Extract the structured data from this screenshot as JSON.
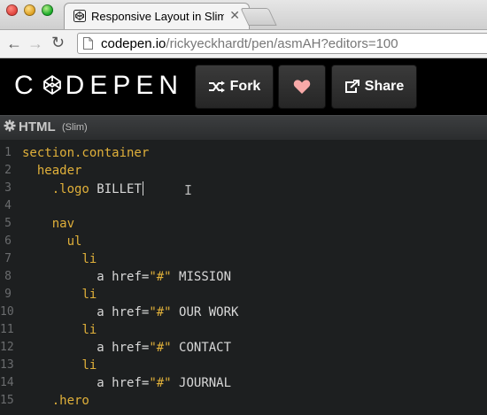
{
  "browser": {
    "tab_title": "Responsive Layout in Slim",
    "tab_close": "✕",
    "url_domain": "codepen.io",
    "url_path": "/rickyeckhardt/pen/asmAH?editors=100"
  },
  "header": {
    "logo_left": "C",
    "logo_right": "DEPEN",
    "fork_label": "Fork",
    "share_label": "Share"
  },
  "pane": {
    "title": "HTML",
    "subtitle": "(Slim)"
  },
  "editor": {
    "lines": [
      {
        "n": "1",
        "indent": "",
        "kw": "section.container",
        "rest": ""
      },
      {
        "n": "2",
        "indent": "  ",
        "kw": "header",
        "rest": ""
      },
      {
        "n": "3",
        "indent": "    ",
        "kw": ".logo",
        "rest": " BILLET"
      },
      {
        "n": "4",
        "indent": "",
        "kw": "",
        "rest": ""
      },
      {
        "n": "5",
        "indent": "    ",
        "kw": "nav",
        "rest": ""
      },
      {
        "n": "6",
        "indent": "      ",
        "kw": "ul",
        "rest": ""
      },
      {
        "n": "7",
        "indent": "        ",
        "kw": "li",
        "rest": ""
      },
      {
        "n": "8",
        "indent": "          ",
        "kw": "",
        "a": "a href=",
        "s": "\"#\"",
        "rest": " MISSION"
      },
      {
        "n": "9",
        "indent": "        ",
        "kw": "li",
        "rest": ""
      },
      {
        "n": "10",
        "indent": "          ",
        "kw": "",
        "a": "a href=",
        "s": "\"#\"",
        "rest": " OUR WORK"
      },
      {
        "n": "11",
        "indent": "        ",
        "kw": "li",
        "rest": ""
      },
      {
        "n": "12",
        "indent": "          ",
        "kw": "",
        "a": "a href=",
        "s": "\"#\"",
        "rest": " CONTACT"
      },
      {
        "n": "13",
        "indent": "        ",
        "kw": "li",
        "rest": ""
      },
      {
        "n": "14",
        "indent": "          ",
        "kw": "",
        "a": "a href=",
        "s": "\"#\"",
        "rest": " JOURNAL"
      },
      {
        "n": "15",
        "indent": "    ",
        "kw": ".hero",
        "rest": ""
      }
    ]
  },
  "colors": {
    "accent_heart": "#f7a9a8",
    "keyword": "#e0b03a"
  }
}
